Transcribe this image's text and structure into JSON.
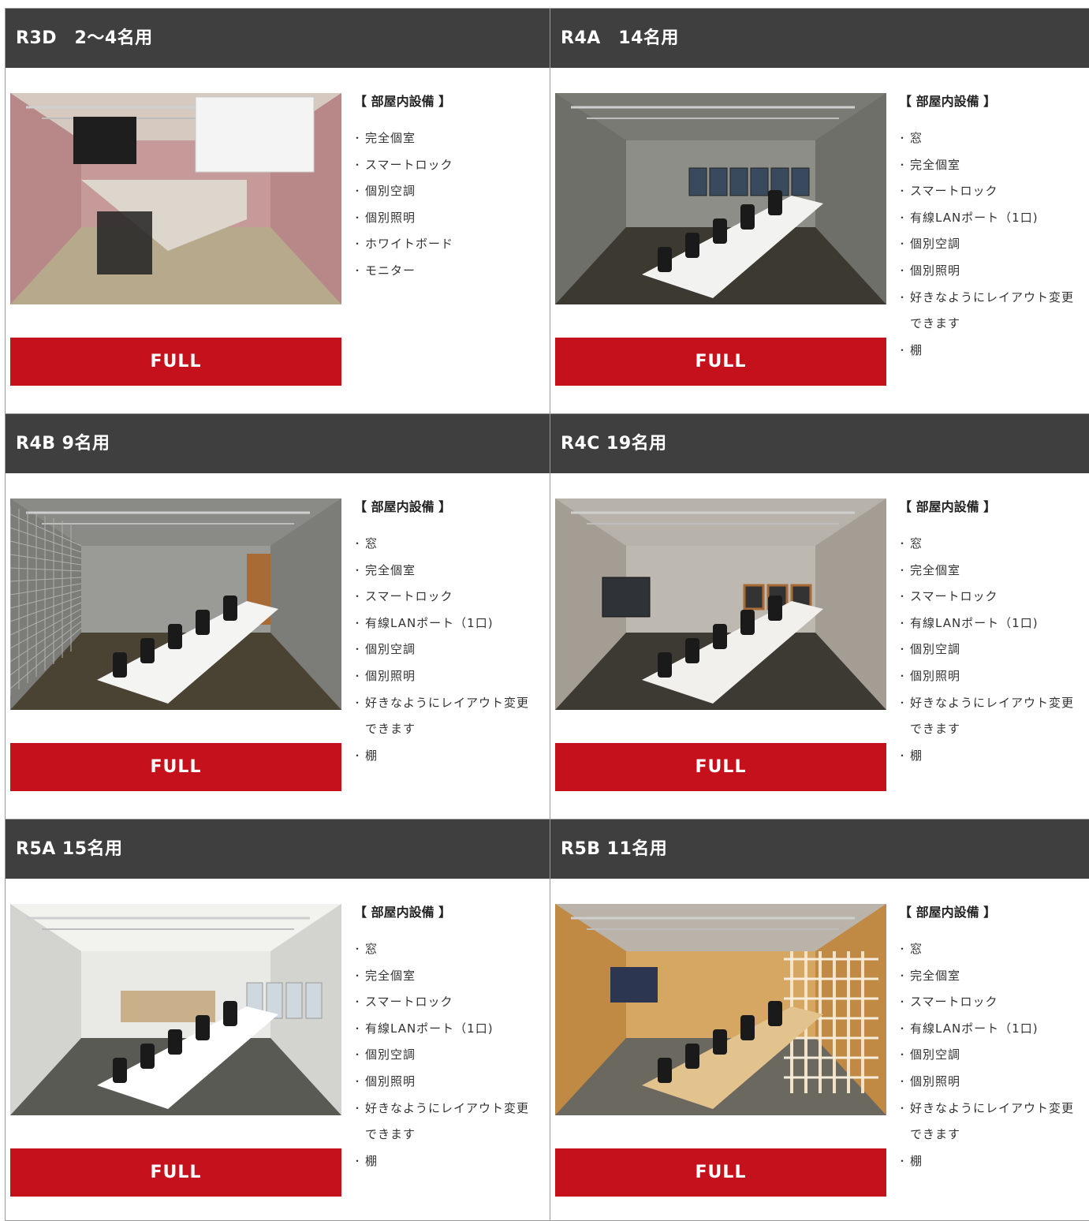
{
  "amenities_title": "【 部屋内設備 】",
  "button_label": "FULL",
  "colors": {
    "header_bg": "#3f3f3f",
    "button_bg": "#c4111b",
    "border": "#9a9a9a"
  },
  "rooms": [
    {
      "title": "R3D　2〜4名用",
      "amenities": [
        "完全個室",
        "スマートロック",
        "個別空調",
        "個別照明",
        "ホワイトボード",
        "モニター"
      ]
    },
    {
      "title": "R4A　14名用",
      "amenities": [
        "窓",
        "完全個室",
        "スマートロック",
        "有線LANポート（1口)",
        "個別空調",
        "個別照明",
        "好きなようにレイアウト変更できます",
        "棚"
      ]
    },
    {
      "title": "R4B 9名用",
      "amenities": [
        "窓",
        "完全個室",
        "スマートロック",
        "有線LANポート（1口)",
        "個別空調",
        "個別照明",
        "好きなようにレイアウト変更できます",
        "棚"
      ]
    },
    {
      "title": "R4C 19名用",
      "amenities": [
        "窓",
        "完全個室",
        "スマートロック",
        "有線LANポート（1口)",
        "個別空調",
        "個別照明",
        "好きなようにレイアウト変更できます",
        "棚"
      ]
    },
    {
      "title": "R5A 15名用",
      "amenities": [
        "窓",
        "完全個室",
        "スマートロック",
        "有線LANポート（1口)",
        "個別空調",
        "個別照明",
        "好きなようにレイアウト変更できます",
        "棚"
      ]
    },
    {
      "title": "R5B 11名用",
      "amenities": [
        "窓",
        "完全個室",
        "スマートロック",
        "有線LANポート（1口)",
        "個別空調",
        "個別照明",
        "好きなようにレイアウト変更できます",
        "棚"
      ]
    }
  ]
}
